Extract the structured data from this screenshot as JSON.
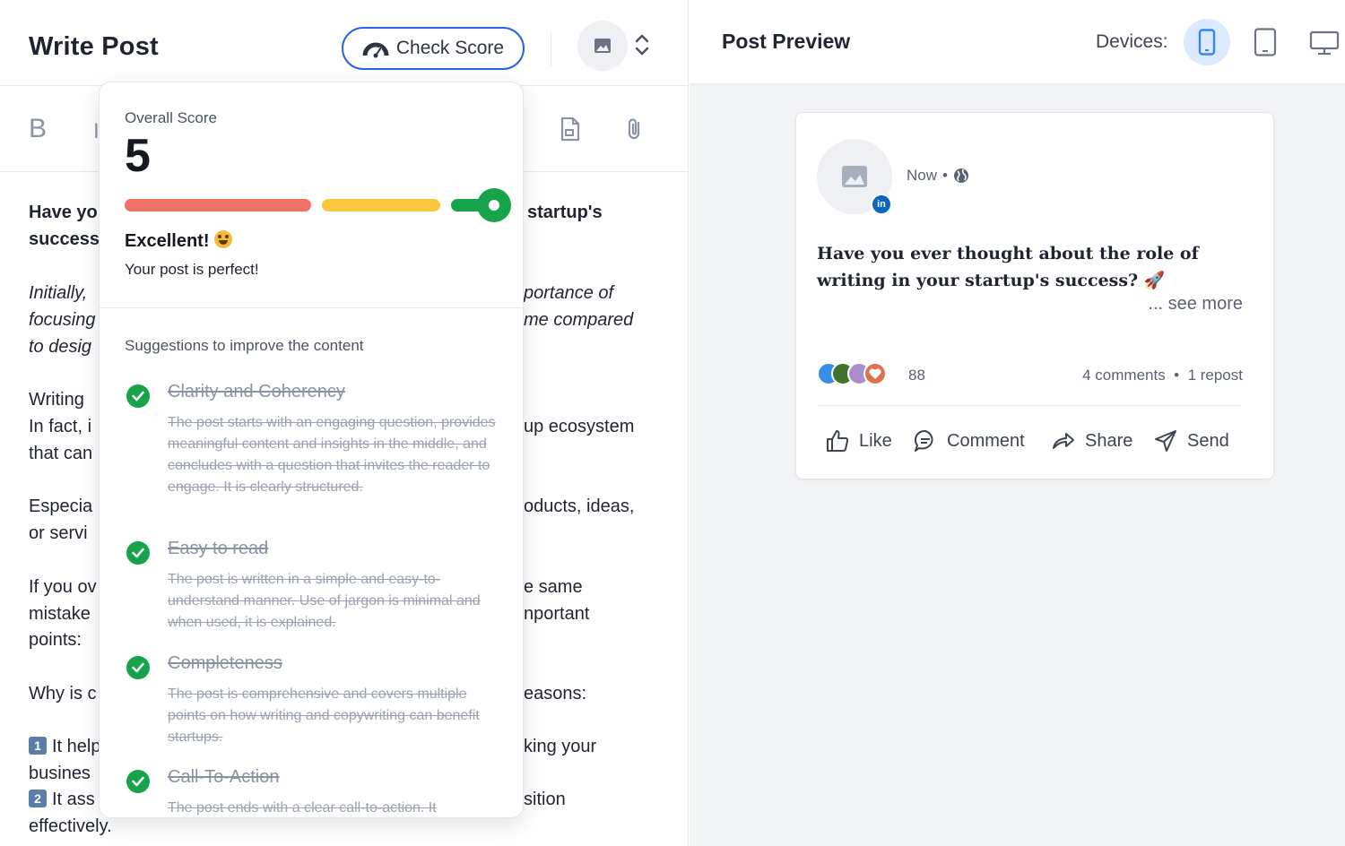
{
  "editor": {
    "title": "Write Post",
    "check_score_label": "Check Score",
    "toolbar": {
      "bold": "B",
      "italic": "I"
    },
    "lines": [
      {
        "left": "Have yo",
        "right": "startup's",
        "style": "bold"
      },
      {
        "left": "success",
        "right": "",
        "style": "bold"
      },
      {
        "left": "Initially,",
        "right": "portance of",
        "style": "italic"
      },
      {
        "left": "focusing",
        "right": "me compared",
        "style": "italic"
      },
      {
        "left": "to desig",
        "right": "",
        "style": "italic"
      },
      {
        "left": "Writing",
        "right": "",
        "style": "normal"
      },
      {
        "left": "In fact, i",
        "right": "up ecosystem",
        "style": "normal"
      },
      {
        "left": "that can",
        "right": "",
        "style": "normal"
      },
      {
        "left": "Especia",
        "right": "oducts, ideas,",
        "style": "normal"
      },
      {
        "left": "or servi",
        "right": "",
        "style": "normal"
      },
      {
        "left": "If you ov",
        "right": "e same",
        "style": "normal"
      },
      {
        "left": "mistake",
        "right": "nportant",
        "style": "normal"
      },
      {
        "left": "points:",
        "right": "",
        "style": "normal"
      },
      {
        "left": "Why is c",
        "right": "easons:",
        "style": "normal"
      },
      {
        "left": "It help",
        "right": "king your",
        "style": "normal",
        "badge": "1"
      },
      {
        "left": "busines",
        "right": "",
        "style": "normal"
      },
      {
        "left": "It ass",
        "right": "sition",
        "style": "normal",
        "badge": "2"
      },
      {
        "left": "effectively.",
        "right": "",
        "style": "normal"
      }
    ]
  },
  "score": {
    "label": "Overall Score",
    "value": "5",
    "status": "Excellent!",
    "message": "Your post is perfect!",
    "suggestions_title": "Suggestions to improve the content",
    "suggestions": [
      {
        "title": "Clarity and Coherency",
        "desc": "The post starts with an engaging question, provides meaningful content and insights in the middle, and concludes with a question that invites the reader to engage. It is clearly structured."
      },
      {
        "title": "Easy to read",
        "desc": "The post is written in a simple and easy-to-understand manner. Use of jargon is minimal and when used, it is explained."
      },
      {
        "title": "Completeness",
        "desc": "The post is comprehensive and covers multiple points on how writing and copywriting can benefit startups."
      },
      {
        "title": "Call-To-Action",
        "desc": "The post ends with a clear call-to-action. It"
      }
    ]
  },
  "preview": {
    "title": "Post Preview",
    "devices_label": "Devices:",
    "time": "Now",
    "text": "Have you ever thought about the role of writing in your startup's success? 🚀",
    "see_more": "... see more",
    "reactions_count": "88",
    "comments": "4 comments",
    "reposts": "1 repost",
    "actions": [
      "Like",
      "Comment",
      "Share",
      "Send"
    ],
    "colors": {
      "accent": "#2563eb",
      "linkedin": "#0a66c2",
      "success": "#16a34a"
    }
  }
}
